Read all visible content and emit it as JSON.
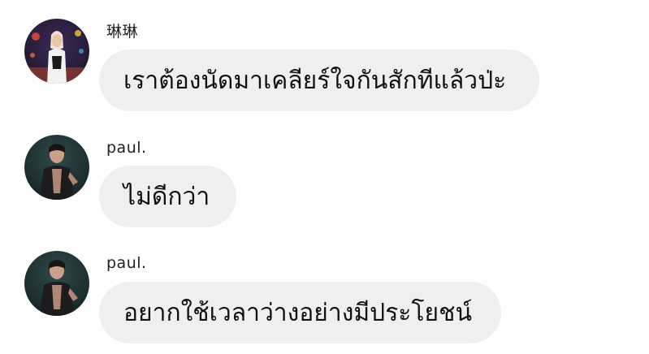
{
  "messages": [
    {
      "sender": "琳琳",
      "text": "เราต้องนัดมาเคลียร์ใจกันสักทีแล้วป่ะ"
    },
    {
      "sender": "paul.",
      "text": "ไม่ดีกว่า"
    },
    {
      "sender": "paul.",
      "text": "อยากใช้เวลาว่างอย่างมีประโยชน์"
    }
  ],
  "colors": {
    "bubble_background": "#efefef",
    "page_background": "#ffffff"
  }
}
